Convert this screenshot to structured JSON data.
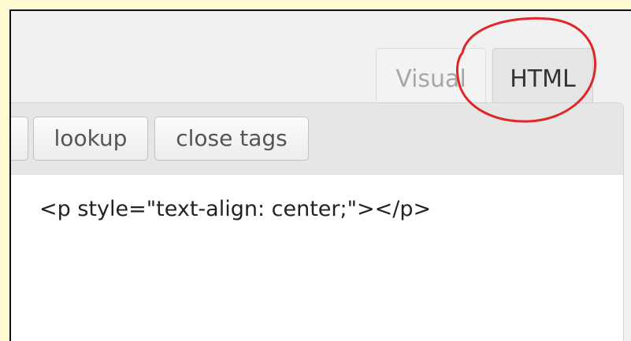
{
  "tabs": {
    "visual_label": "Visual",
    "html_label": "HTML",
    "active": "HTML"
  },
  "toolbar": {
    "lookup_label": "lookup",
    "close_tags_label": "close tags"
  },
  "editor": {
    "content": "<p style=\"text-align: center;\"></p>"
  },
  "annotation": {
    "color": "#e0262b",
    "target": "HTML tab"
  },
  "colors": {
    "page_background": "#fffbd0",
    "toolbar_background": "#e6e6e6",
    "active_tab_background": "#e5e5e5"
  }
}
